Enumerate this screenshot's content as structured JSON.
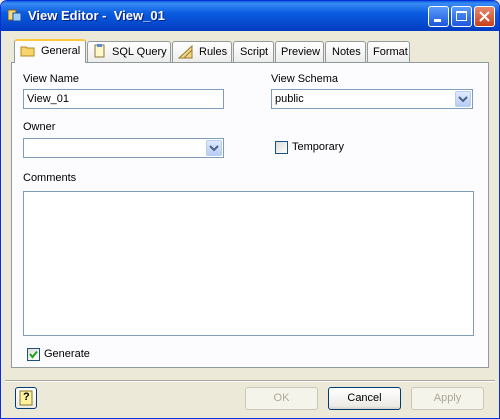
{
  "window": {
    "title": "View Editor -  View_01"
  },
  "tabs": [
    {
      "label": "General",
      "active": true,
      "icon": "folder-icon"
    },
    {
      "label": "SQL Query",
      "active": false,
      "icon": "document-icon"
    },
    {
      "label": "Rules",
      "active": false,
      "icon": "ruler-icon"
    },
    {
      "label": "Script",
      "active": false
    },
    {
      "label": "Preview",
      "active": false
    },
    {
      "label": "Notes",
      "active": false
    },
    {
      "label": "Format",
      "active": false
    }
  ],
  "general": {
    "view_name_label": "View Name",
    "view_name_value": "View_01",
    "view_schema_label": "View Schema",
    "view_schema_value": "public",
    "owner_label": "Owner",
    "owner_value": "",
    "temporary_label": "Temporary",
    "temporary_checked": false,
    "comments_label": "Comments",
    "comments_value": "",
    "generate_label": "Generate",
    "generate_checked": true
  },
  "footer": {
    "help_label": "?",
    "ok_label": "OK",
    "cancel_label": "Cancel",
    "apply_label": "Apply"
  }
}
